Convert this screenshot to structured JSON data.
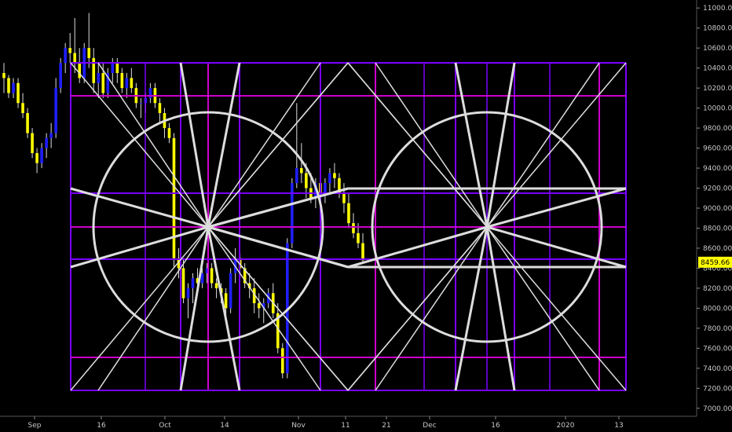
{
  "chart_data": {
    "type": "candlestick",
    "colors": {
      "background": "#000000",
      "candle_up": "#1f1fff",
      "candle_down": "#ffff00",
      "wick": "#dddddd",
      "grid_violet": "#7a00ff",
      "grid_magenta": "#cc00cc",
      "circle": "#dddddd",
      "price_tag": "#ffff00"
    },
    "y_axis": {
      "ticks": [
        "11000.00",
        "10800.00",
        "10600.00",
        "10400.00",
        "10200.00",
        "10000.00",
        "9800.00",
        "9600.00",
        "9400.00",
        "9200.00",
        "9000.00",
        "8800.00",
        "8600.00",
        "8400.00",
        "8200.00",
        "8000.00",
        "7800.00",
        "7600.00",
        "7400.00",
        "7200.00",
        "7000.00"
      ],
      "ylim": [
        6920,
        11080
      ],
      "last_price": "8459.66"
    },
    "x_axis": {
      "ticks": [
        "Sep",
        "16",
        "Oct",
        "14",
        "Nov",
        "11",
        "21",
        "Dec",
        "16",
        "2020",
        "13"
      ]
    },
    "candles": [
      [
        10350,
        10450,
        10150,
        10300
      ],
      [
        10300,
        10330,
        10100,
        10150
      ],
      [
        10150,
        10300,
        10100,
        10250
      ],
      [
        10250,
        10300,
        10000,
        10050
      ],
      [
        10050,
        10150,
        9900,
        9950
      ],
      [
        9950,
        10000,
        9700,
        9750
      ],
      [
        9750,
        9800,
        9500,
        9550
      ],
      [
        9550,
        9600,
        9350,
        9450
      ],
      [
        9450,
        9650,
        9400,
        9600
      ],
      [
        9600,
        9750,
        9500,
        9700
      ],
      [
        9700,
        9850,
        9600,
        9750
      ],
      [
        9750,
        10300,
        9700,
        10200
      ],
      [
        10200,
        10500,
        10150,
        10450
      ],
      [
        10450,
        10650,
        10350,
        10600
      ],
      [
        10600,
        10750,
        10450,
        10550
      ],
      [
        10550,
        10900,
        10350,
        10450
      ],
      [
        10450,
        10600,
        10250,
        10300
      ],
      [
        10300,
        10650,
        10250,
        10600
      ],
      [
        10600,
        10950,
        10400,
        10500
      ],
      [
        10500,
        10600,
        10150,
        10250
      ],
      [
        10250,
        10450,
        10100,
        10350
      ],
      [
        10350,
        10450,
        10100,
        10150
      ],
      [
        10150,
        10400,
        10100,
        10350
      ],
      [
        10350,
        10500,
        10250,
        10450
      ],
      [
        10450,
        10500,
        10250,
        10350
      ],
      [
        10350,
        10400,
        10150,
        10200
      ],
      [
        10200,
        10350,
        10100,
        10300
      ],
      [
        10300,
        10400,
        10150,
        10200
      ],
      [
        10200,
        10250,
        10000,
        10050
      ],
      [
        10050,
        10100,
        9900,
        10050
      ],
      [
        10050,
        10150,
        9950,
        10100
      ],
      [
        10100,
        10250,
        10050,
        10200
      ],
      [
        10200,
        10250,
        10000,
        10050
      ],
      [
        10050,
        10100,
        9850,
        9950
      ],
      [
        9950,
        10000,
        9700,
        9800
      ],
      [
        9800,
        9850,
        9650,
        9700
      ],
      [
        9700,
        9750,
        8400,
        8500
      ],
      [
        8500,
        8600,
        8300,
        8400
      ],
      [
        8400,
        8500,
        8050,
        8100
      ],
      [
        8100,
        8250,
        7900,
        8200
      ],
      [
        8200,
        8350,
        8050,
        8300
      ],
      [
        8300,
        8400,
        8150,
        8250
      ],
      [
        8250,
        8400,
        8200,
        8350
      ],
      [
        8350,
        8450,
        8250,
        8400
      ],
      [
        8400,
        8450,
        8200,
        8250
      ],
      [
        8250,
        8300,
        8100,
        8200
      ],
      [
        8200,
        8250,
        8050,
        8150
      ],
      [
        8150,
        8200,
        7900,
        8000
      ],
      [
        8000,
        8400,
        7950,
        8350
      ],
      [
        8350,
        8600,
        8250,
        8500
      ],
      [
        8500,
        8550,
        8300,
        8400
      ],
      [
        8400,
        8450,
        8200,
        8250
      ],
      [
        8250,
        8350,
        8100,
        8200
      ],
      [
        8200,
        8300,
        7950,
        8050
      ],
      [
        8050,
        8150,
        7900,
        8000
      ],
      [
        8000,
        8100,
        7850,
        8050
      ],
      [
        8050,
        8200,
        8000,
        8150
      ],
      [
        8150,
        8250,
        7900,
        7950
      ],
      [
        7950,
        8050,
        7550,
        7600
      ],
      [
        7600,
        7650,
        7300,
        7350
      ],
      [
        7350,
        8700,
        7300,
        8650
      ],
      [
        8650,
        9300,
        8600,
        9250
      ],
      [
        9250,
        10050,
        9200,
        9400
      ],
      [
        9400,
        9650,
        9250,
        9350
      ],
      [
        9350,
        9450,
        9100,
        9200
      ],
      [
        9200,
        9350,
        9050,
        9100
      ],
      [
        9100,
        9300,
        9000,
        9250
      ],
      [
        9250,
        9350,
        9100,
        9150
      ],
      [
        9150,
        9300,
        9050,
        9250
      ],
      [
        9250,
        9400,
        9150,
        9350
      ],
      [
        9350,
        9450,
        9200,
        9300
      ],
      [
        9300,
        9350,
        9100,
        9150
      ],
      [
        9150,
        9250,
        8950,
        9050
      ],
      [
        9050,
        9150,
        8800,
        8850
      ],
      [
        8850,
        8950,
        8700,
        8750
      ],
      [
        8750,
        8850,
        8600,
        8650
      ],
      [
        8650,
        8750,
        8450,
        8480
      ]
    ]
  }
}
